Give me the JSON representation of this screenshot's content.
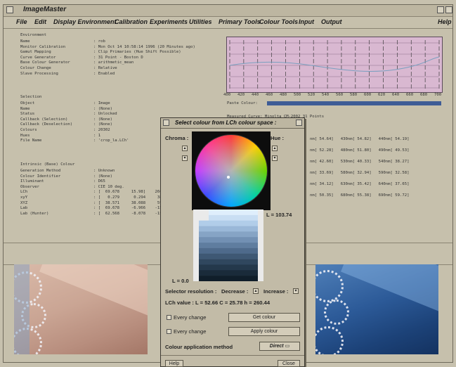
{
  "app": {
    "title": "ImageMaster"
  },
  "menu": [
    "File",
    "Edit",
    "Display Environment",
    "Calibration",
    "Experiments",
    "Utilities",
    "Primary Tools",
    "Colour Tools",
    "Input",
    "Output",
    "Help"
  ],
  "environment": {
    "heading": "Environment",
    "rows": [
      {
        "label": "Name",
        "value": ": rob"
      },
      {
        "label": "Monitor Calibration",
        "value": ": Mon Oct 14 10:58:14 1996 (20 Minutes ago)"
      },
      {
        "label": "Gamut Mapping",
        "value": ": Clip Primaries (Hue Shift Possible)"
      },
      {
        "label": "Curve Generator",
        "value": ": 31 Point - Boston D"
      },
      {
        "label": "Base Colour Generator",
        "value": ": arithmetic_mean"
      },
      {
        "label": "Colour Change",
        "value": ": Relative"
      },
      {
        "label": "Slave Processing",
        "value": ": Enabled"
      }
    ]
  },
  "selection": {
    "heading": "Selection",
    "rows": [
      {
        "label": "Object",
        "value": ": Image"
      },
      {
        "label": "Name",
        "value": ": (None)"
      },
      {
        "label": "Status",
        "value": ": Unlocked"
      },
      {
        "label": "Callback (Selection)",
        "value": ": (None)"
      },
      {
        "label": "Callback (Deselection)",
        "value": ": (None)"
      },
      {
        "label": "Colours",
        "value": ": 20302"
      },
      {
        "label": "Hues",
        "value": ": 1"
      },
      {
        "label": "File Name",
        "value": ": 'crop_la.LCh'"
      }
    ]
  },
  "intrinsic": {
    "heading": "Intrinsic (Base) Colour",
    "rows": [
      {
        "label": "Generation Method",
        "value": ": Unknown"
      },
      {
        "label": "Colour Identifier",
        "value": ": (None)"
      },
      {
        "label": "Illuminant",
        "value": ": D65"
      },
      {
        "label": "Observer",
        "value": ": CIE 10 deg."
      },
      {
        "label": "LCh",
        "value": ": [  69.678     15.98]    260.438]"
      },
      {
        "label": "xyY",
        "value": ": [   0.279      0.294     38.088]"
      },
      {
        "label": "XYZ",
        "value": ": [  38.571     38.088     59.671]"
      },
      {
        "label": "Lab",
        "value": ": [  69.678     -6.966    -15.870]"
      },
      {
        "label": "Lab (Hunter)",
        "value": ": [  62.568     -8.078    -15.101]"
      }
    ]
  },
  "graph": {
    "paste_label": "Paste Colour:",
    "ticks": [
      "400",
      "420",
      "440",
      "460",
      "480",
      "500",
      "520",
      "540",
      "560",
      "580",
      "600",
      "620",
      "640",
      "660",
      "680",
      "700"
    ]
  },
  "measured": {
    "heading": "Measured Curve: Minolta CM-2002 31 Points",
    "rows": [
      "nm[ 54.64]   430nm[ 54.82]   440nm[ 54.19]",
      "nm[ 52.28]   480nm[ 51.80]   490nm[ 49.53]",
      "nm[ 42.60]   530nm[ 40.33]   540nm[ 38.27]",
      "nm[ 33.69]   580nm[ 32.94]   590nm[ 32.58]",
      "nm[ 34.12]   630nm[ 35.42]   640nm[ 37.65]",
      "nm[ 50.35]   680nm[ 55.38]   690nm[ 59.72]"
    ]
  },
  "dialog": {
    "title": "Select colour from LCh colour space :",
    "chroma_label": "Chroma :",
    "hue_label": "Hue :",
    "l_top": "L = 103.74",
    "l_bottom": "L = 0.0",
    "resolution_label": "Selector resolution :",
    "decrease_label": "Decrease :",
    "increase_label": "Increase :",
    "lch_value": "LCh value :  L = 52.66    C = 25.78    h = 260.44",
    "every_change_1": "Every change",
    "every_change_2": "Every change",
    "get_colour": "Get colour",
    "apply_colour": "Apply colour",
    "method_label": "Colour application method",
    "method_value": "Direct",
    "help": "Help",
    "close": "Close",
    "swatches": [
      "#dfeefc",
      "#c9def3",
      "#b1cde9",
      "#9ab8d8",
      "#86a4c5",
      "#7290b3",
      "#5f7d9f",
      "#4e6a8b",
      "#3e5874",
      "#30475e",
      "#24384b",
      "#1a2b3a",
      "#101e2a"
    ]
  }
}
